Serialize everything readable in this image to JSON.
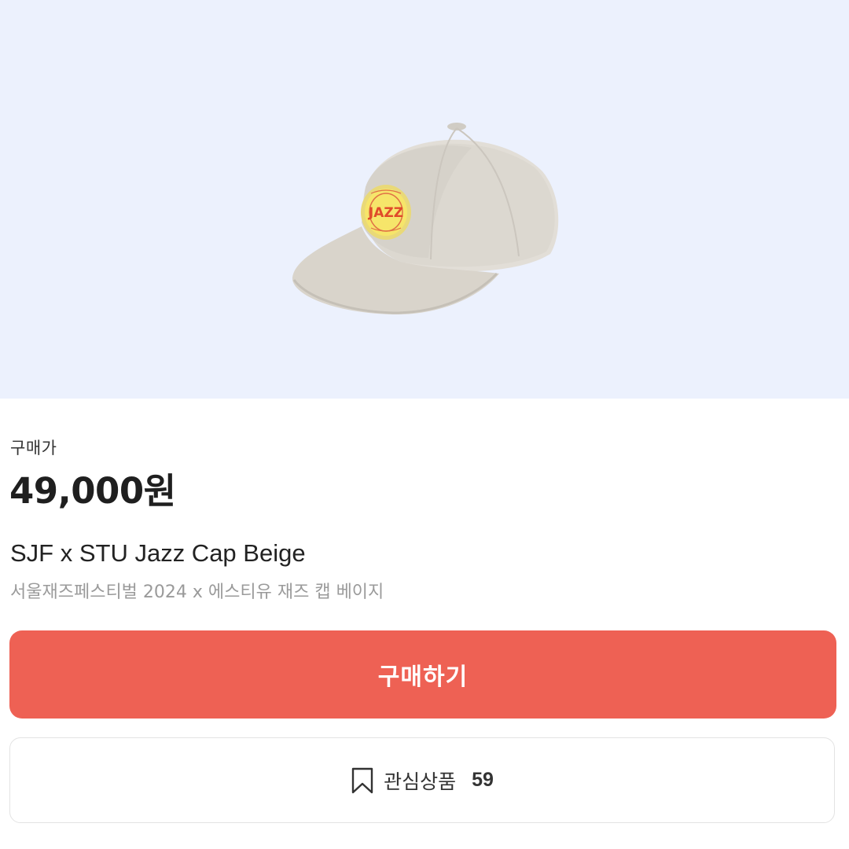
{
  "product": {
    "image_alt": "Jazz cap beige",
    "patch_text": "JAZZ",
    "price_label": "구매가",
    "price": "49,000원",
    "name": "SJF x STU Jazz Cap Beige",
    "subname": "서울재즈페스티벌 2024 x 에스티유 재즈 캡 베이지"
  },
  "actions": {
    "buy_label": "구매하기",
    "wishlist_label": "관심상품",
    "wishlist_count": "59",
    "wishlist_icon": "bookmark-icon"
  },
  "colors": {
    "image_background": "#ecf1fd",
    "buy_button": "#ee6154",
    "subname_text": "#9a9a9a"
  }
}
